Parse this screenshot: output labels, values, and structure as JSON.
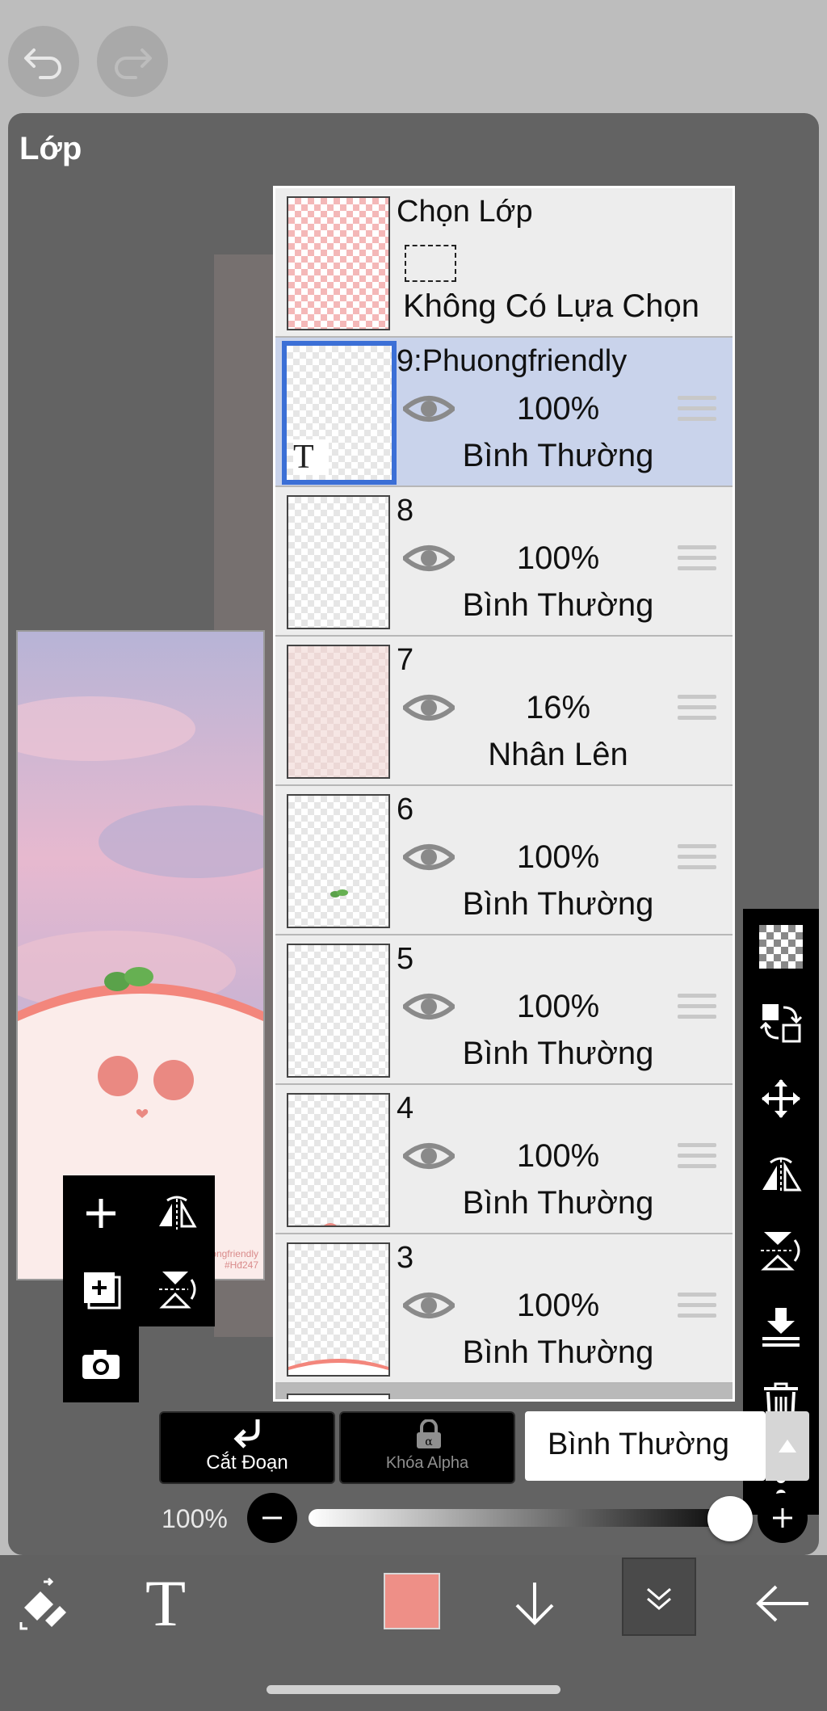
{
  "header": {
    "undo_icon": "undo-icon",
    "redo_icon": "redo-icon"
  },
  "panel": {
    "title": "Lớp"
  },
  "preview": {
    "watermark_line1": "Phuongfriendly",
    "watermark_line2": "#Hđ247"
  },
  "selection_row": {
    "title": "Chọn Lớp",
    "status": "Không Có Lựa Chọn"
  },
  "layers": [
    {
      "name": "9:Phuongfriendly",
      "opacity": "100%",
      "blend": "Bình Thường",
      "selected": true,
      "badge": "T"
    },
    {
      "name": "8",
      "opacity": "100%",
      "blend": "Bình Thường"
    },
    {
      "name": "7",
      "opacity": "16%",
      "blend": "Nhân Lên"
    },
    {
      "name": "6",
      "opacity": "100%",
      "blend": "Bình Thường"
    },
    {
      "name": "5",
      "opacity": "100%",
      "blend": "Bình Thường"
    },
    {
      "name": "4",
      "opacity": "100%",
      "blend": "Bình Thường"
    },
    {
      "name": "3",
      "opacity": "100%",
      "blend": "Bình Thường"
    }
  ],
  "controls": {
    "clip_label": "Cắt Đoạn",
    "alpha_lock_label": "Khóa Alpha",
    "blend_mode": "Bình Thường",
    "opacity_value": "100%",
    "opacity_fraction": 1.0
  },
  "colors": {
    "current_color": "#ee8f87",
    "selection_highlight": "#3b6fd6",
    "panel_bg": "#636363"
  },
  "bottom_bar": {
    "text_tool_glyph": "T"
  }
}
